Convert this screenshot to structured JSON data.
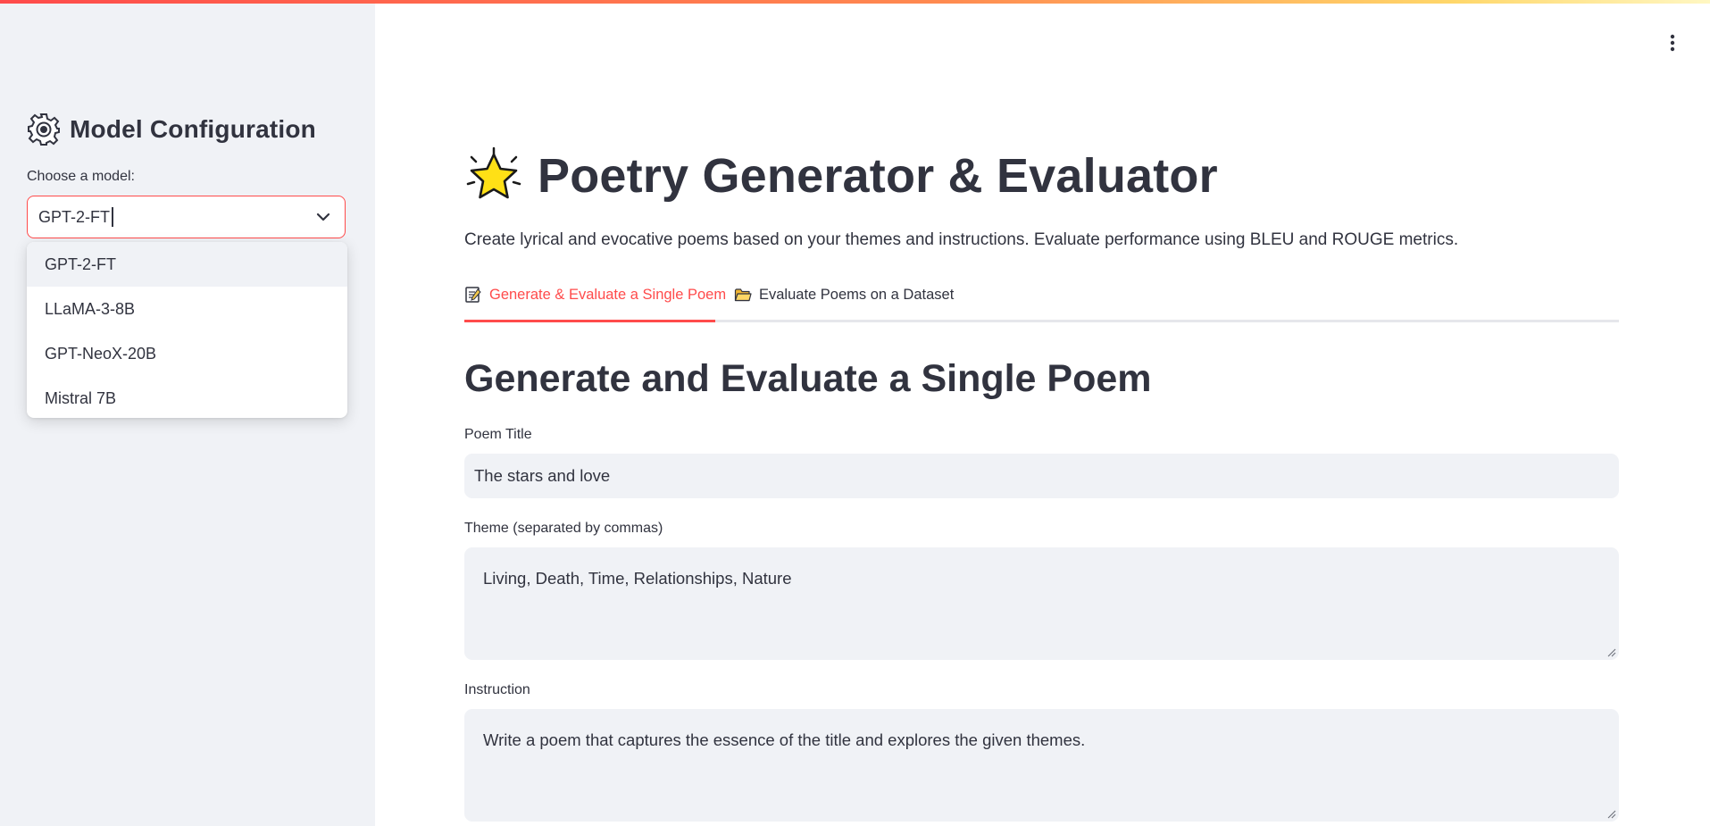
{
  "sidebar": {
    "title": "Model Configuration",
    "select_label": "Choose a model:",
    "select_value": "GPT-2-FT",
    "options": [
      "GPT-2-FT",
      "LLaMA-3-8B",
      "GPT-NeoX-20B",
      "Mistral 7B"
    ]
  },
  "main": {
    "title": "Poetry Generator & Evaluator",
    "subtitle": "Create lyrical and evocative poems based on your themes and instructions. Evaluate performance using BLEU and ROUGE metrics.",
    "tabs": [
      {
        "label": "Generate & Evaluate a Single Poem",
        "icon": "memo-icon"
      },
      {
        "label": "Evaluate Poems on a Dataset",
        "icon": "folder-icon"
      }
    ],
    "section_heading": "Generate and Evaluate a Single Poem",
    "fields": {
      "poem_title": {
        "label": "Poem Title",
        "value": "The stars and love"
      },
      "theme": {
        "label": "Theme (separated by commas)",
        "value": "Living, Death, Time, Relationships, Nature"
      },
      "instruction": {
        "label": "Instruction",
        "value": "Write a poem that captures the essence of the title and explores the given themes."
      }
    }
  },
  "colors": {
    "accent": "#ff4b4b",
    "sidebar_bg": "#f0f2f6",
    "input_bg": "#f0f2f6",
    "text": "#31333f"
  }
}
